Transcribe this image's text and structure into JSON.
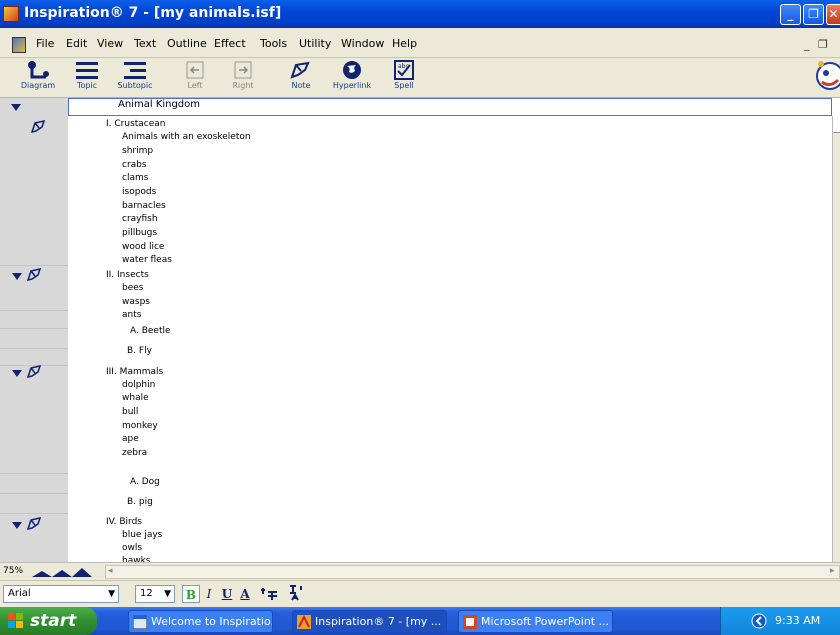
{
  "window": {
    "title": "Inspiration® 7 - [my animals.isf]",
    "controls": {
      "minimize": "_",
      "maximize": "❐",
      "close": "✕"
    }
  },
  "menu": {
    "items": [
      "File",
      "Edit",
      "View",
      "Text",
      "Outline",
      "Effect",
      "Tools",
      "Utility",
      "Window",
      "Help"
    ],
    "mdi_minimize": "_",
    "mdi_restore": "❐"
  },
  "toolbar": {
    "buttons": [
      {
        "label": "Diagram",
        "icon": "diagram-icon",
        "enabled": true
      },
      {
        "label": "Topic",
        "icon": "topic-icon",
        "enabled": true
      },
      {
        "label": "Subtopic",
        "icon": "subtopic-icon",
        "enabled": true
      },
      {
        "label": "Left",
        "icon": "left-arrow-icon",
        "enabled": false
      },
      {
        "label": "Right",
        "icon": "right-arrow-icon",
        "enabled": false
      },
      {
        "label": "Note",
        "icon": "note-pencil-icon",
        "enabled": true
      },
      {
        "label": "Hyperlink",
        "icon": "globe-icon",
        "enabled": true
      },
      {
        "label": "Spell",
        "icon": "spell-check-icon",
        "enabled": true
      }
    ]
  },
  "outline": {
    "main_idea": "Animal Kingdom",
    "lines": {
      "crustacean": "I.  Crustacean",
      "crustacean_note": [
        "Animals with an exoskeleton",
        "shrimp",
        "crabs",
        "clams",
        "isopods",
        "barnacles",
        "crayfish",
        "pillbugs",
        "wood lice",
        "water fleas"
      ],
      "insects": "II.  Insects",
      "insects_note": [
        "bees",
        "wasps",
        "ants"
      ],
      "beetle": "A.  Beetle",
      "fly": "B.  Fly",
      "mammals": "III.  Mammals",
      "mammals_note": [
        "dolphin",
        "whale",
        "bull",
        "monkey",
        "ape",
        "zebra"
      ],
      "dog": "A.  Dog",
      "pig": "B.  pig",
      "birds": "IV.  Birds",
      "birds_note": [
        "blue jays",
        "owls",
        "hawks"
      ]
    }
  },
  "zoom": {
    "level": "75%"
  },
  "format": {
    "font": "Arial",
    "size": "12",
    "bold": "B",
    "italic": "I",
    "underline": "U",
    "color": "A"
  },
  "taskbar": {
    "start_label": "start",
    "tasks": [
      {
        "label": "Welcome to Inspiratio...",
        "active": false
      },
      {
        "label": "Inspiration® 7 - [my ...",
        "active": true
      },
      {
        "label": "Microsoft PowerPoint ...",
        "active": false
      }
    ],
    "clock": "9:33 AM"
  },
  "colors": {
    "title_bar": "#0346d6",
    "chrome": "#ece9d8",
    "gutter": "#d8d8d8",
    "taskbar": "#245edb",
    "start": "#2f8f2f",
    "toolbar_label": "#1a3f8f"
  }
}
